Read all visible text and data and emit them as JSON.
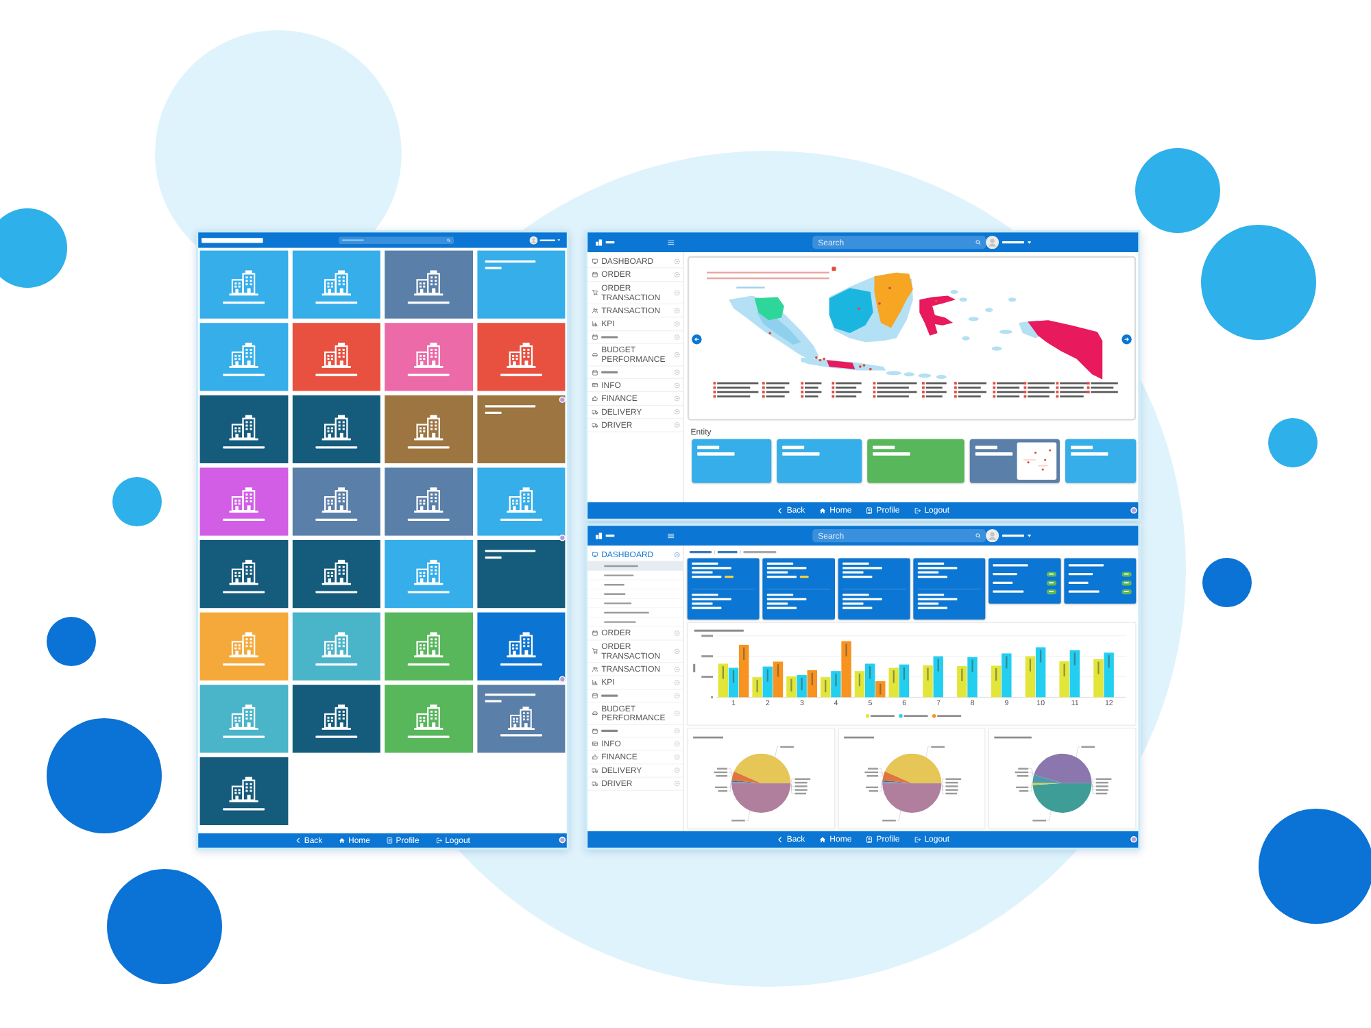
{
  "tile_app": {
    "tiles": [
      {
        "kind": "building",
        "color": "#35aeea"
      },
      {
        "kind": "building",
        "color": "#35aeea"
      },
      {
        "kind": "building",
        "color": "#5a7fa8"
      },
      {
        "kind": "text",
        "color": "#35aeea"
      },
      {
        "kind": "building",
        "color": "#35aeea"
      },
      {
        "kind": "building",
        "color": "#e8503f"
      },
      {
        "kind": "building",
        "color": "#ec6aa8"
      },
      {
        "kind": "building",
        "color": "#e8503f"
      },
      {
        "kind": "building",
        "color": "#155b7c"
      },
      {
        "kind": "building",
        "color": "#155b7c"
      },
      {
        "kind": "building",
        "color": "#9c7541"
      },
      {
        "kind": "text",
        "color": "#9c7541"
      },
      {
        "kind": "building",
        "color": "#d25ee6"
      },
      {
        "kind": "building",
        "color": "#5a7fa8"
      },
      {
        "kind": "building",
        "color": "#5a7fa8"
      },
      {
        "kind": "building",
        "color": "#35aeea"
      },
      {
        "kind": "building",
        "color": "#155b7c"
      },
      {
        "kind": "building",
        "color": "#155b7c"
      },
      {
        "kind": "building",
        "color": "#35aeea"
      },
      {
        "kind": "text",
        "color": "#155b7c"
      },
      {
        "kind": "building",
        "color": "#f5a93b"
      },
      {
        "kind": "building",
        "color": "#4ab4c9"
      },
      {
        "kind": "building",
        "color": "#58b65b"
      },
      {
        "kind": "building",
        "color": "#0c74d2"
      },
      {
        "kind": "building",
        "color": "#4ab4c9"
      },
      {
        "kind": "building",
        "color": "#155b7c"
      },
      {
        "kind": "building",
        "color": "#58b65b"
      },
      {
        "kind": "text-building",
        "color": "#5a7fa8"
      },
      {
        "kind": "building",
        "color": "#155b7c"
      }
    ],
    "footer": [
      {
        "label": "Back"
      },
      {
        "label": "Home"
      },
      {
        "label": "Profile"
      },
      {
        "label": "Logout"
      }
    ]
  },
  "map_app": {
    "search": {
      "placeholder": "Search"
    },
    "sidebar": [
      {
        "label": "DASHBOARD",
        "expanded": false
      },
      {
        "label": "ORDER",
        "expanded": false
      },
      {
        "label": "ORDER TRANSACTION",
        "expanded": false
      },
      {
        "label": "TRANSACTION",
        "expanded": false
      },
      {
        "label": "KPI",
        "expanded": false
      },
      {
        "expanded": false
      },
      {
        "label": "BUDGET PERFORMANCE",
        "expanded": false
      },
      {
        "expanded": false
      },
      {
        "label": "INFO",
        "expanded": false
      },
      {
        "label": "FINANCE",
        "expanded": false
      },
      {
        "label": "DELIVERY",
        "expanded": false
      },
      {
        "label": "DRIVER",
        "expanded": false
      }
    ],
    "entity": {
      "title": "Entity",
      "cards": [
        {
          "kind": "plain",
          "color": "#35aeea"
        },
        {
          "kind": "plain",
          "color": "#35aeea"
        },
        {
          "kind": "plain",
          "color": "#58b65b"
        },
        {
          "kind": "map",
          "color": "#5a7fa8"
        },
        {
          "kind": "plain",
          "color": "#35aeea"
        }
      ]
    },
    "footer": [
      {
        "label": "Back"
      },
      {
        "label": "Home"
      },
      {
        "label": "Profile"
      },
      {
        "label": "Logout"
      }
    ]
  },
  "dashboard_app": {
    "search": {
      "placeholder": "Search"
    },
    "sidebar": [
      {
        "label": "DASHBOARD",
        "expanded": true,
        "children": [
          {
            "selected": true
          },
          {
            "selected": false
          },
          {
            "selected": false
          },
          {
            "selected": false
          },
          {
            "selected": false
          },
          {
            "selected": false
          },
          {
            "selected": false
          }
        ]
      },
      {
        "label": "ORDER",
        "expanded": false
      },
      {
        "label": "ORDER TRANSACTION",
        "expanded": false
      },
      {
        "label": "TRANSACTION",
        "expanded": false
      },
      {
        "label": "KPI",
        "expanded": false
      },
      {
        "expanded": false
      },
      {
        "label": "BUDGET PERFORMANCE",
        "expanded": false
      },
      {
        "expanded": false
      },
      {
        "label": "INFO",
        "expanded": false
      },
      {
        "label": "FINANCE",
        "expanded": false
      },
      {
        "label": "DELIVERY",
        "expanded": false
      },
      {
        "label": "DRIVER",
        "expanded": false
      }
    ],
    "kpi_cards": [
      {
        "kind": "split",
        "change_note": true
      },
      {
        "kind": "split",
        "change_note": true
      },
      {
        "kind": "split",
        "change_note": false
      },
      {
        "kind": "split",
        "change_note": false
      },
      {
        "kind": "outlet"
      },
      {
        "kind": "outlet"
      }
    ],
    "bar_chart": {
      "x_labels": [
        "1",
        "2",
        "3",
        "4",
        "5",
        "6",
        "7",
        "8",
        "9",
        "10",
        "11",
        "12"
      ],
      "legend": [
        {
          "color": "#e2e639"
        },
        {
          "color": "#22cff0"
        },
        {
          "color": "#f7931e"
        }
      ]
    },
    "pie_panels": [
      {
        "slices": [
          {
            "color": "#b07f9e"
          },
          {
            "color": "#7f9cc0"
          },
          {
            "color": "#4f6d8f"
          },
          {
            "color": "#e0763b"
          },
          {
            "color": "#e5c656"
          }
        ]
      },
      {
        "slices": [
          {
            "color": "#b07f9e"
          },
          {
            "color": "#7f9cc0"
          },
          {
            "color": "#4f6d8f"
          },
          {
            "color": "#e0763b"
          },
          {
            "color": "#e5c656"
          }
        ]
      },
      {
        "slices": [
          {
            "color": "#3f9d98"
          },
          {
            "color": "#d8d04a"
          },
          {
            "color": "#4d9bb1"
          },
          {
            "color": "#8b76ad"
          }
        ]
      }
    ],
    "footer": [
      {
        "label": "Back"
      },
      {
        "label": "Home"
      },
      {
        "label": "Profile"
      },
      {
        "label": "Logout"
      }
    ]
  }
}
